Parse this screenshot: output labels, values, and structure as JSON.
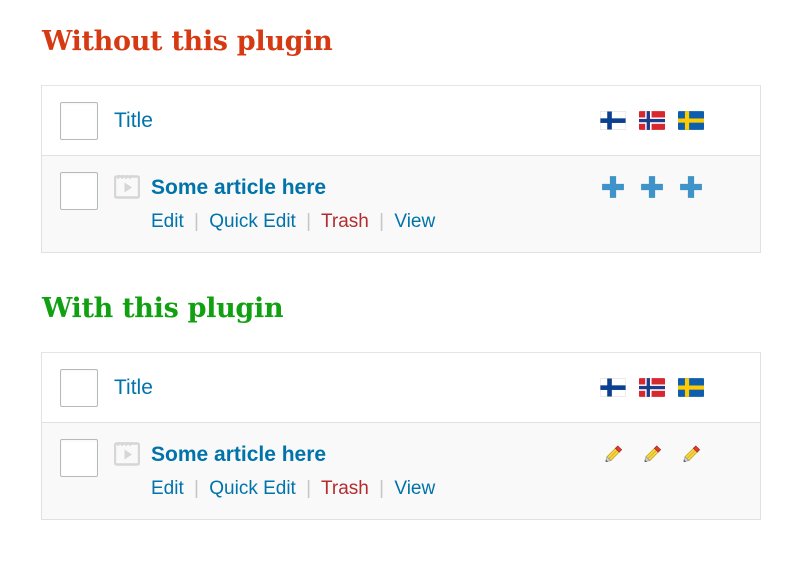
{
  "sections": [
    {
      "heading": "Without this plugin",
      "heading_color": "#d63a12",
      "table": {
        "header": {
          "select_all_name": "select-all-checkbox",
          "title_label": "Title",
          "icon_columns": [
            {
              "name": "flag-finland",
              "label": "Finland"
            },
            {
              "name": "flag-norway",
              "label": "Norway"
            },
            {
              "name": "flag-sweden",
              "label": "Sweden"
            }
          ]
        },
        "rows": [
          {
            "checkbox_name": "row-checkbox",
            "media_icon": "video-icon",
            "title": "Some article here",
            "actions": [
              {
                "label": "Edit",
                "kind": "link"
              },
              {
                "label": "Quick Edit",
                "kind": "link"
              },
              {
                "label": "Trash",
                "kind": "trash"
              },
              {
                "label": "View",
                "kind": "link"
              }
            ],
            "separator": "|",
            "cell_icons": [
              {
                "name": "plus-icon",
                "type": "plus"
              },
              {
                "name": "plus-icon",
                "type": "plus"
              },
              {
                "name": "plus-icon",
                "type": "plus"
              }
            ]
          }
        ]
      }
    },
    {
      "heading": "With this plugin",
      "heading_color": "#11a011",
      "table": {
        "header": {
          "select_all_name": "select-all-checkbox",
          "title_label": "Title",
          "icon_columns": [
            {
              "name": "flag-finland",
              "label": "Finland"
            },
            {
              "name": "flag-norway",
              "label": "Norway"
            },
            {
              "name": "flag-sweden",
              "label": "Sweden"
            }
          ]
        },
        "rows": [
          {
            "checkbox_name": "row-checkbox",
            "media_icon": "video-icon",
            "title": "Some article here",
            "actions": [
              {
                "label": "Edit",
                "kind": "link"
              },
              {
                "label": "Quick Edit",
                "kind": "link"
              },
              {
                "label": "Trash",
                "kind": "trash"
              },
              {
                "label": "View",
                "kind": "link"
              }
            ],
            "separator": "|",
            "cell_icons": [
              {
                "name": "pencil-icon",
                "type": "pencil"
              },
              {
                "name": "pencil-icon",
                "type": "pencil"
              },
              {
                "name": "pencil-icon",
                "type": "pencil"
              }
            ]
          }
        ]
      }
    }
  ],
  "colors": {
    "link_blue": "#0073aa",
    "trash_red": "#b32d2e",
    "plus_blue": "#3f93c8",
    "row_background": "#f9f9f9",
    "border": "#e1e1e1"
  }
}
